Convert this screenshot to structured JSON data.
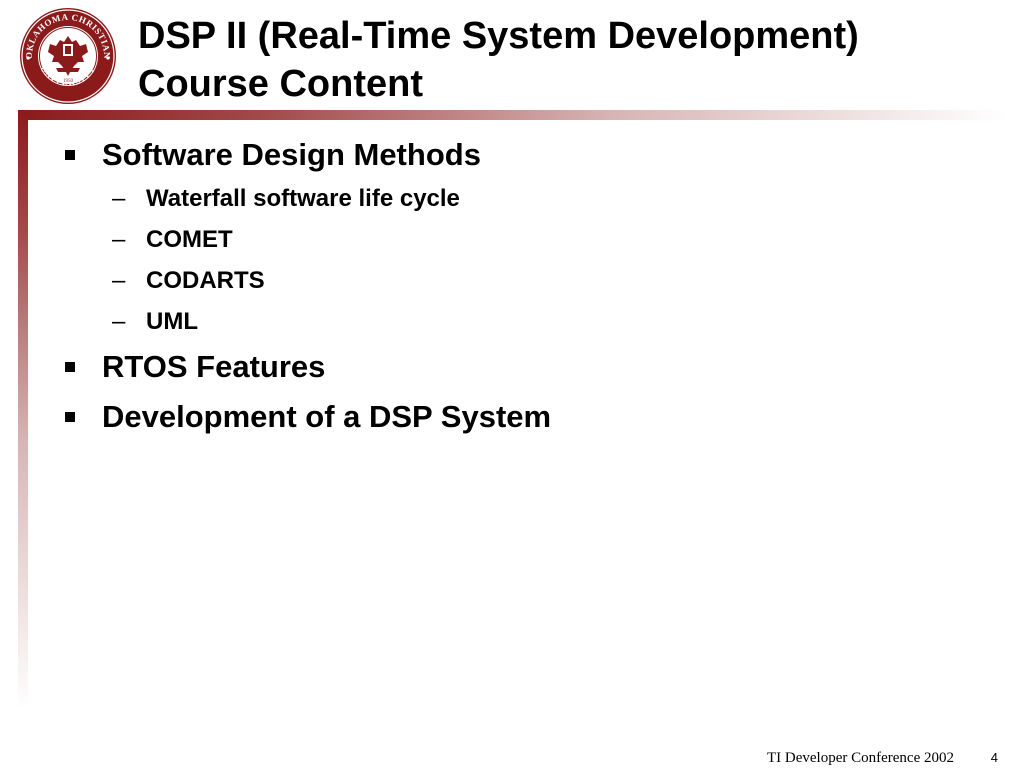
{
  "title": {
    "line1": "DSP II (Real-Time System Development)",
    "line2": "Course Content"
  },
  "logo": {
    "name": "Oklahoma Christian University seal",
    "ring_text_top": "OKLAHOMA CHRISTIAN",
    "ring_text_bottom": "UNIVERSITY",
    "year": "1950",
    "color": "#8b1a1a"
  },
  "bullets": [
    {
      "text": "Software Design Methods",
      "sub": [
        {
          "text": "Waterfall software life cycle"
        },
        {
          "text": "COMET"
        },
        {
          "text": "CODARTS"
        },
        {
          "text": "UML"
        }
      ]
    },
    {
      "text": "RTOS Features"
    },
    {
      "text": "Development of a DSP System"
    }
  ],
  "footer": {
    "text": "TI Developer Conference 2002",
    "page_number": "4"
  },
  "colors": {
    "accent": "#8b1a1a",
    "text": "#000000",
    "background": "#ffffff"
  },
  "icons": {
    "level1_bullet": "square-bullet-icon",
    "level2_bullet": "dash"
  },
  "symbols": {
    "dash": "–"
  }
}
